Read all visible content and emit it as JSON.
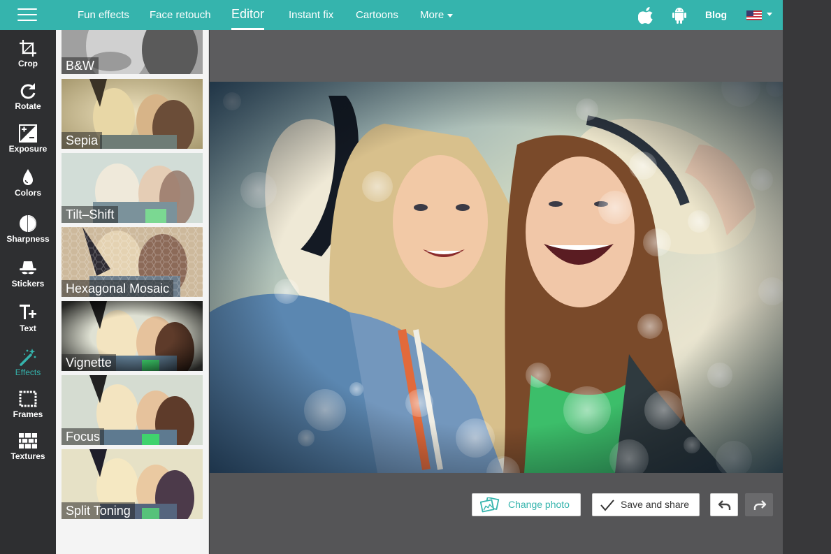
{
  "nav": {
    "items": [
      {
        "label": "Fun effects"
      },
      {
        "label": "Face retouch"
      },
      {
        "label": "Editor"
      },
      {
        "label": "Instant fix"
      },
      {
        "label": "Cartoons"
      },
      {
        "label": "More"
      }
    ],
    "blog_label": "Blog"
  },
  "tools": [
    {
      "label": "Crop",
      "icon": "crop-icon"
    },
    {
      "label": "Rotate",
      "icon": "rotate-icon"
    },
    {
      "label": "Exposure",
      "icon": "exposure-icon"
    },
    {
      "label": "Colors",
      "icon": "colors-icon"
    },
    {
      "label": "Sharpness",
      "icon": "sharpness-icon"
    },
    {
      "label": "Stickers",
      "icon": "stickers-icon"
    },
    {
      "label": "Text",
      "icon": "text-icon"
    },
    {
      "label": "Effects",
      "icon": "effects-icon"
    },
    {
      "label": "Frames",
      "icon": "frames-icon"
    },
    {
      "label": "Textures",
      "icon": "textures-icon"
    }
  ],
  "effects": [
    {
      "label": "B&W"
    },
    {
      "label": "Sepia"
    },
    {
      "label": "Tilt–Shift"
    },
    {
      "label": "Hexagonal Mosaic"
    },
    {
      "label": "Vignette"
    },
    {
      "label": "Focus"
    },
    {
      "label": "Split Toning"
    }
  ],
  "buttons": {
    "change_photo": "Change photo",
    "save_share": "Save and share"
  },
  "colors": {
    "accent": "#35b4ad",
    "toolbar": "#2e2f31",
    "workspace": "#555557"
  }
}
